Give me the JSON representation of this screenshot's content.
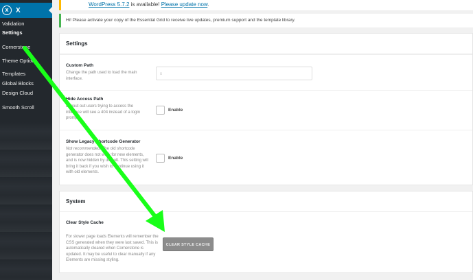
{
  "sidebar": {
    "x_icon": "x-circle-icon",
    "x_icon_glyph": "x",
    "x_label": "X",
    "items": [
      {
        "label": "Validation",
        "active": false
      },
      {
        "label": "Settings",
        "active": true
      },
      {
        "label": "Cornerstone",
        "active": false
      },
      {
        "label": "Theme Options",
        "active": false
      },
      {
        "label": "Templates",
        "active": false
      },
      {
        "label": "Global Blocks",
        "active": false
      },
      {
        "label": "Design Cloud",
        "active": false
      },
      {
        "label": "Smooth Scroll",
        "active": false
      }
    ]
  },
  "notices": {
    "update_link": "WordPress 5.7.2",
    "update_mid": " is available! ",
    "update_action": "Please update now",
    "update_end": ".",
    "essential_grid": "Hi! Please activate your copy of the Essential Grid to receive live updates, premium support and the template library."
  },
  "settings": {
    "title": "Settings",
    "custom_path": {
      "label": "Custom Path",
      "desc": "Change the path used to load the main interface.",
      "value": "x"
    },
    "hide_access_path": {
      "label": "Hide Access Path",
      "desc": "Logout out users trying to access the interface will see a 404 instead of a login prompt.",
      "check_label": "Enable"
    },
    "legacy_generator": {
      "label": "Show Legacy Shortcode Generator",
      "desc_em": "Not recommended.",
      "desc": " The old shortcode generator does not work for new elements, and is now hidden by default. This setting will bring it back if you wish to continue using it with old elements.",
      "check_label": "Enable"
    }
  },
  "system": {
    "title": "System",
    "clear_cache": {
      "label": "Clear Style Cache",
      "desc": "For slower page loads Elements will remember the CSS generated when they were last saved. This is automatically cleared when Cornerstone is updated. It may be useful to clear manually if any Elements are missing styling.",
      "button": "CLEAR STYLE CACHE"
    }
  },
  "annotation": {
    "arrow_color": "#19ff19"
  },
  "colors": {
    "sidebar_bg": "#23282d",
    "accent": "#0073aa",
    "update_notice": "#ffb900",
    "success_notice": "#46b450",
    "button": "#8c8c8c"
  }
}
